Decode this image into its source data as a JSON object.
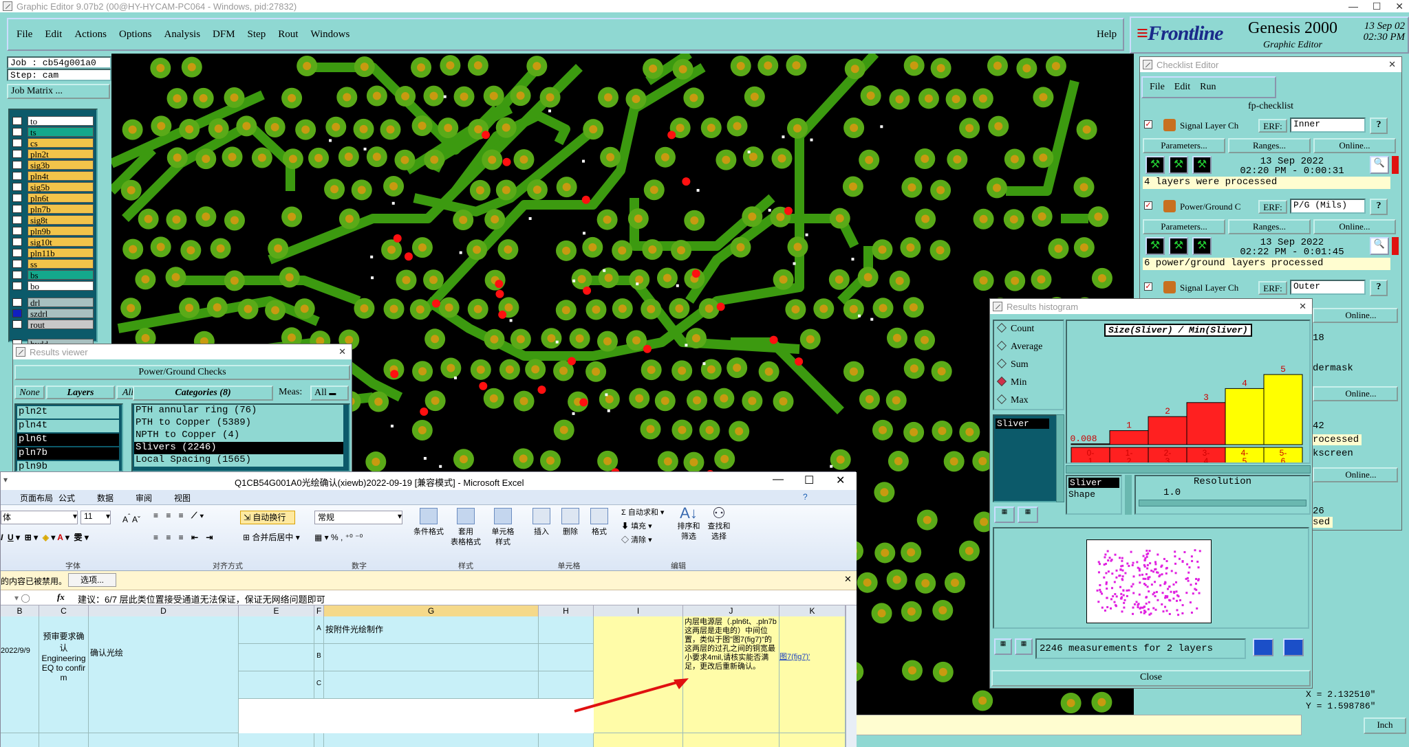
{
  "main_window": {
    "title": "Graphic Editor 9.07b2 (00@HY-HYCAM-PC064 - Windows, pid:27832)"
  },
  "menu": [
    "File",
    "Edit",
    "Actions",
    "Options",
    "Analysis",
    "DFM",
    "Step",
    "Rout",
    "Windows"
  ],
  "help": "Help",
  "brand": {
    "logo": "Frontline",
    "product": "Genesis 2000",
    "subtitle": "Graphic Editor",
    "date": "13 Sep 02",
    "time": "02:30 PM"
  },
  "job": {
    "job_label": "Job : cb54g001a0",
    "step_label": "Step: cam",
    "matrix_button": "Job Matrix ..."
  },
  "layers": [
    {
      "name": "to",
      "color": "#ffffff"
    },
    {
      "name": "ts",
      "color": "#14a88c"
    },
    {
      "name": "cs",
      "color": "#f2c44a"
    },
    {
      "name": "pln2t",
      "color": "#f2c44a"
    },
    {
      "name": "sig3b",
      "color": "#f2c44a"
    },
    {
      "name": "pln4t",
      "color": "#f2c44a"
    },
    {
      "name": "sig5b",
      "color": "#f2c44a"
    },
    {
      "name": "pln6t",
      "color": "#f2c44a"
    },
    {
      "name": "pln7b",
      "color": "#f2c44a"
    },
    {
      "name": "sig8t",
      "color": "#f2c44a"
    },
    {
      "name": "pln9b",
      "color": "#f2c44a"
    },
    {
      "name": "sig10t",
      "color": "#f2c44a"
    },
    {
      "name": "pln11b",
      "color": "#f2c44a"
    },
    {
      "name": "ss",
      "color": "#f2c44a"
    },
    {
      "name": "bs",
      "color": "#14a88c"
    },
    {
      "name": "bo",
      "color": "#ffffff"
    }
  ],
  "layers2": [
    {
      "name": "drl",
      "color": "#a8c0c0"
    },
    {
      "name": "szdrl",
      "color": "#a8c0c0"
    },
    {
      "name": "rout",
      "color": "#c8c8c8"
    },
    {
      "name": "hydd",
      "color": "#a8c0c0"
    }
  ],
  "results_viewer": {
    "title": "Results viewer",
    "header": "Power/Ground Checks",
    "none": "None",
    "layers": "Layers",
    "all": "All",
    "categories_title": "Categories (8)",
    "meas_label": "Meas:",
    "meas_value": "All",
    "layer_list": [
      "pln2t",
      "pln4t",
      "pln6t",
      "pln7b",
      "pln9b"
    ],
    "categories": [
      "PTH annular ring (76)",
      "PTH to Copper (5389)",
      "NPTH to Copper (4)",
      "Slivers (2246)",
      "Local Spacing (1565)"
    ]
  },
  "checklist": {
    "title": "Checklist Editor",
    "menu": [
      "File",
      "Edit",
      "Run"
    ],
    "name": "fp-checklist",
    "erf": "ERF:",
    "parameters": "Parameters...",
    "ranges": "Ranges...",
    "online": "Online...",
    "items": [
      {
        "name": "Signal Layer Ch",
        "erf_value": "Inner",
        "date": "13 Sep 2022",
        "time": "02:20 PM - 0:00:31",
        "status": "4 layers were processed"
      },
      {
        "name": "Power/Ground C",
        "erf_value": "P/G (Mils)",
        "date": "13 Sep 2022",
        "time": "02:22 PM - 0:01:45",
        "status": "6 power/ground layers processed"
      },
      {
        "name": "Signal Layer Ch",
        "erf_value": "Outer",
        "date": "",
        "time": "",
        "status": ""
      }
    ],
    "partial": [
      "18",
      "dermask",
      "42",
      "rocessed",
      "kscreen",
      "26",
      "sed"
    ]
  },
  "histogram": {
    "title": "Results histogram",
    "modes": [
      "Count",
      "Average",
      "Sum",
      "Min",
      "Max"
    ],
    "selected_mode": "Min",
    "chart_title": "Size(Sliver) / Min(Sliver)",
    "list_item": "Sliver",
    "shape_label": "Shape",
    "resolution_label": "Resolution",
    "resolution_value": "1.0",
    "summary": "2246 measurements for 2 layers",
    "close": "Close"
  },
  "chart_data": {
    "type": "bar",
    "title": "Size(Sliver) / Min(Sliver)",
    "categories": [
      "0-1",
      "1-2",
      "2-3",
      "3-4",
      "4-5",
      "5-6"
    ],
    "values": [
      0.008,
      1,
      2,
      3,
      4,
      5
    ],
    "labels": [
      "0.008",
      "1",
      "2",
      "3",
      "4",
      "5"
    ],
    "ylim": [
      0,
      5
    ],
    "colors": [
      "#ff2020",
      "#ff2020",
      "#ff2020",
      "#ff2020",
      "#ffff00",
      "#ffff00"
    ]
  },
  "coords": {
    "x": "X = 2.132510\"",
    "y": "Y = 1.598786\"",
    "unit": "Inch"
  },
  "excel": {
    "title": "Q1CB54G001A0光绘确认(xiewb)2022-09-19  [兼容模式] - Microsoft Excel",
    "tabs": [
      "页面布局",
      "公式",
      "数据",
      "审阅",
      "视图"
    ],
    "font": "体",
    "size": "11",
    "format": "常规",
    "wrap": "自动换行",
    "merge": "合并后居中",
    "groups": [
      "字体",
      "对齐方式",
      "数字",
      "样式",
      "单元格",
      "编辑"
    ],
    "style_buttons": [
      "条件格式",
      "套用\n表格格式",
      "单元格\n样式"
    ],
    "cell_buttons": [
      "插入",
      "删除",
      "格式"
    ],
    "edit_buttons": [
      "自动求和",
      "填充",
      "清除",
      "排序和\n筛选",
      "查找和\n选择"
    ],
    "security": "的内容已被禁用。",
    "options": "选项...",
    "fx": "fx",
    "formula": "建议：6/7 层此类位置接受通道无法保证，保证无网络问题即可",
    "cols": [
      "B",
      "C",
      "D",
      "E",
      "F",
      "G",
      "H",
      "I",
      "J",
      "K"
    ],
    "cells": {
      "date": "2022/9/9",
      "c": "预审要求确认\nEngineering EQ to confirm",
      "d": "确认光绘",
      "fA": "A",
      "fB": "B",
      "fC": "C",
      "g": "按附件光绘制作",
      "j": "内层电源层（.pln6t、.pln7b 这两层是走电的）中间位置，类似于图\"图7(fig7)\"的这两层的过孔之间的铜宽最小要求4mil,请核实能否满足，更改后重新确认。",
      "k": "图7(fig7)'"
    }
  }
}
